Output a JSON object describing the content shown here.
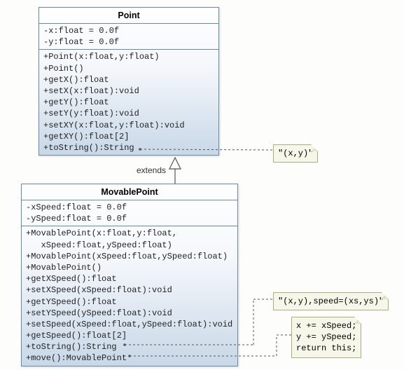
{
  "classes": {
    "point": {
      "name": "Point",
      "attributes": [
        "-x:float = 0.0f",
        "-y:float = 0.0f"
      ],
      "operations": [
        "+Point(x:float,y:float)",
        "+Point()",
        "+getX():float",
        "+setX(x:float):void",
        "+getY():float",
        "+setY(y:float):void",
        "+setXY(x:float,y:float):void",
        "+getXY():float[2]",
        "+toString():String"
      ]
    },
    "movable": {
      "name": "MovablePoint",
      "attributes": [
        "-xSpeed:float = 0.0f",
        "-ySpeed:float = 0.0f"
      ],
      "operations": [
        "+MovablePoint(x:float,y:float,",
        "   xSpeed:float,ySpeed:float)",
        "+MovablePoint(xSpeed:float,ySpeed:float)",
        "+MovablePoint()",
        "+getXSpeed():float",
        "+setXSpeed(xSpeed:float):void",
        "+getYSpeed():float",
        "+setYSpeed(ySpeed:float):void",
        "+setSpeed(xSpeed:float,ySpeed:float):void",
        "+getSpeed():float[2]",
        "+toString():String",
        "+move():MovablePoint"
      ]
    }
  },
  "relationship": {
    "label": "extends"
  },
  "notes": {
    "point_tostring": "\"(x,y)\"",
    "movable_tostring": "\"(x,y),speed=(xs,ys)\"",
    "move_body0": "x += xSpeed;",
    "move_body1": "y += ySpeed;",
    "move_body2": "return this;"
  }
}
